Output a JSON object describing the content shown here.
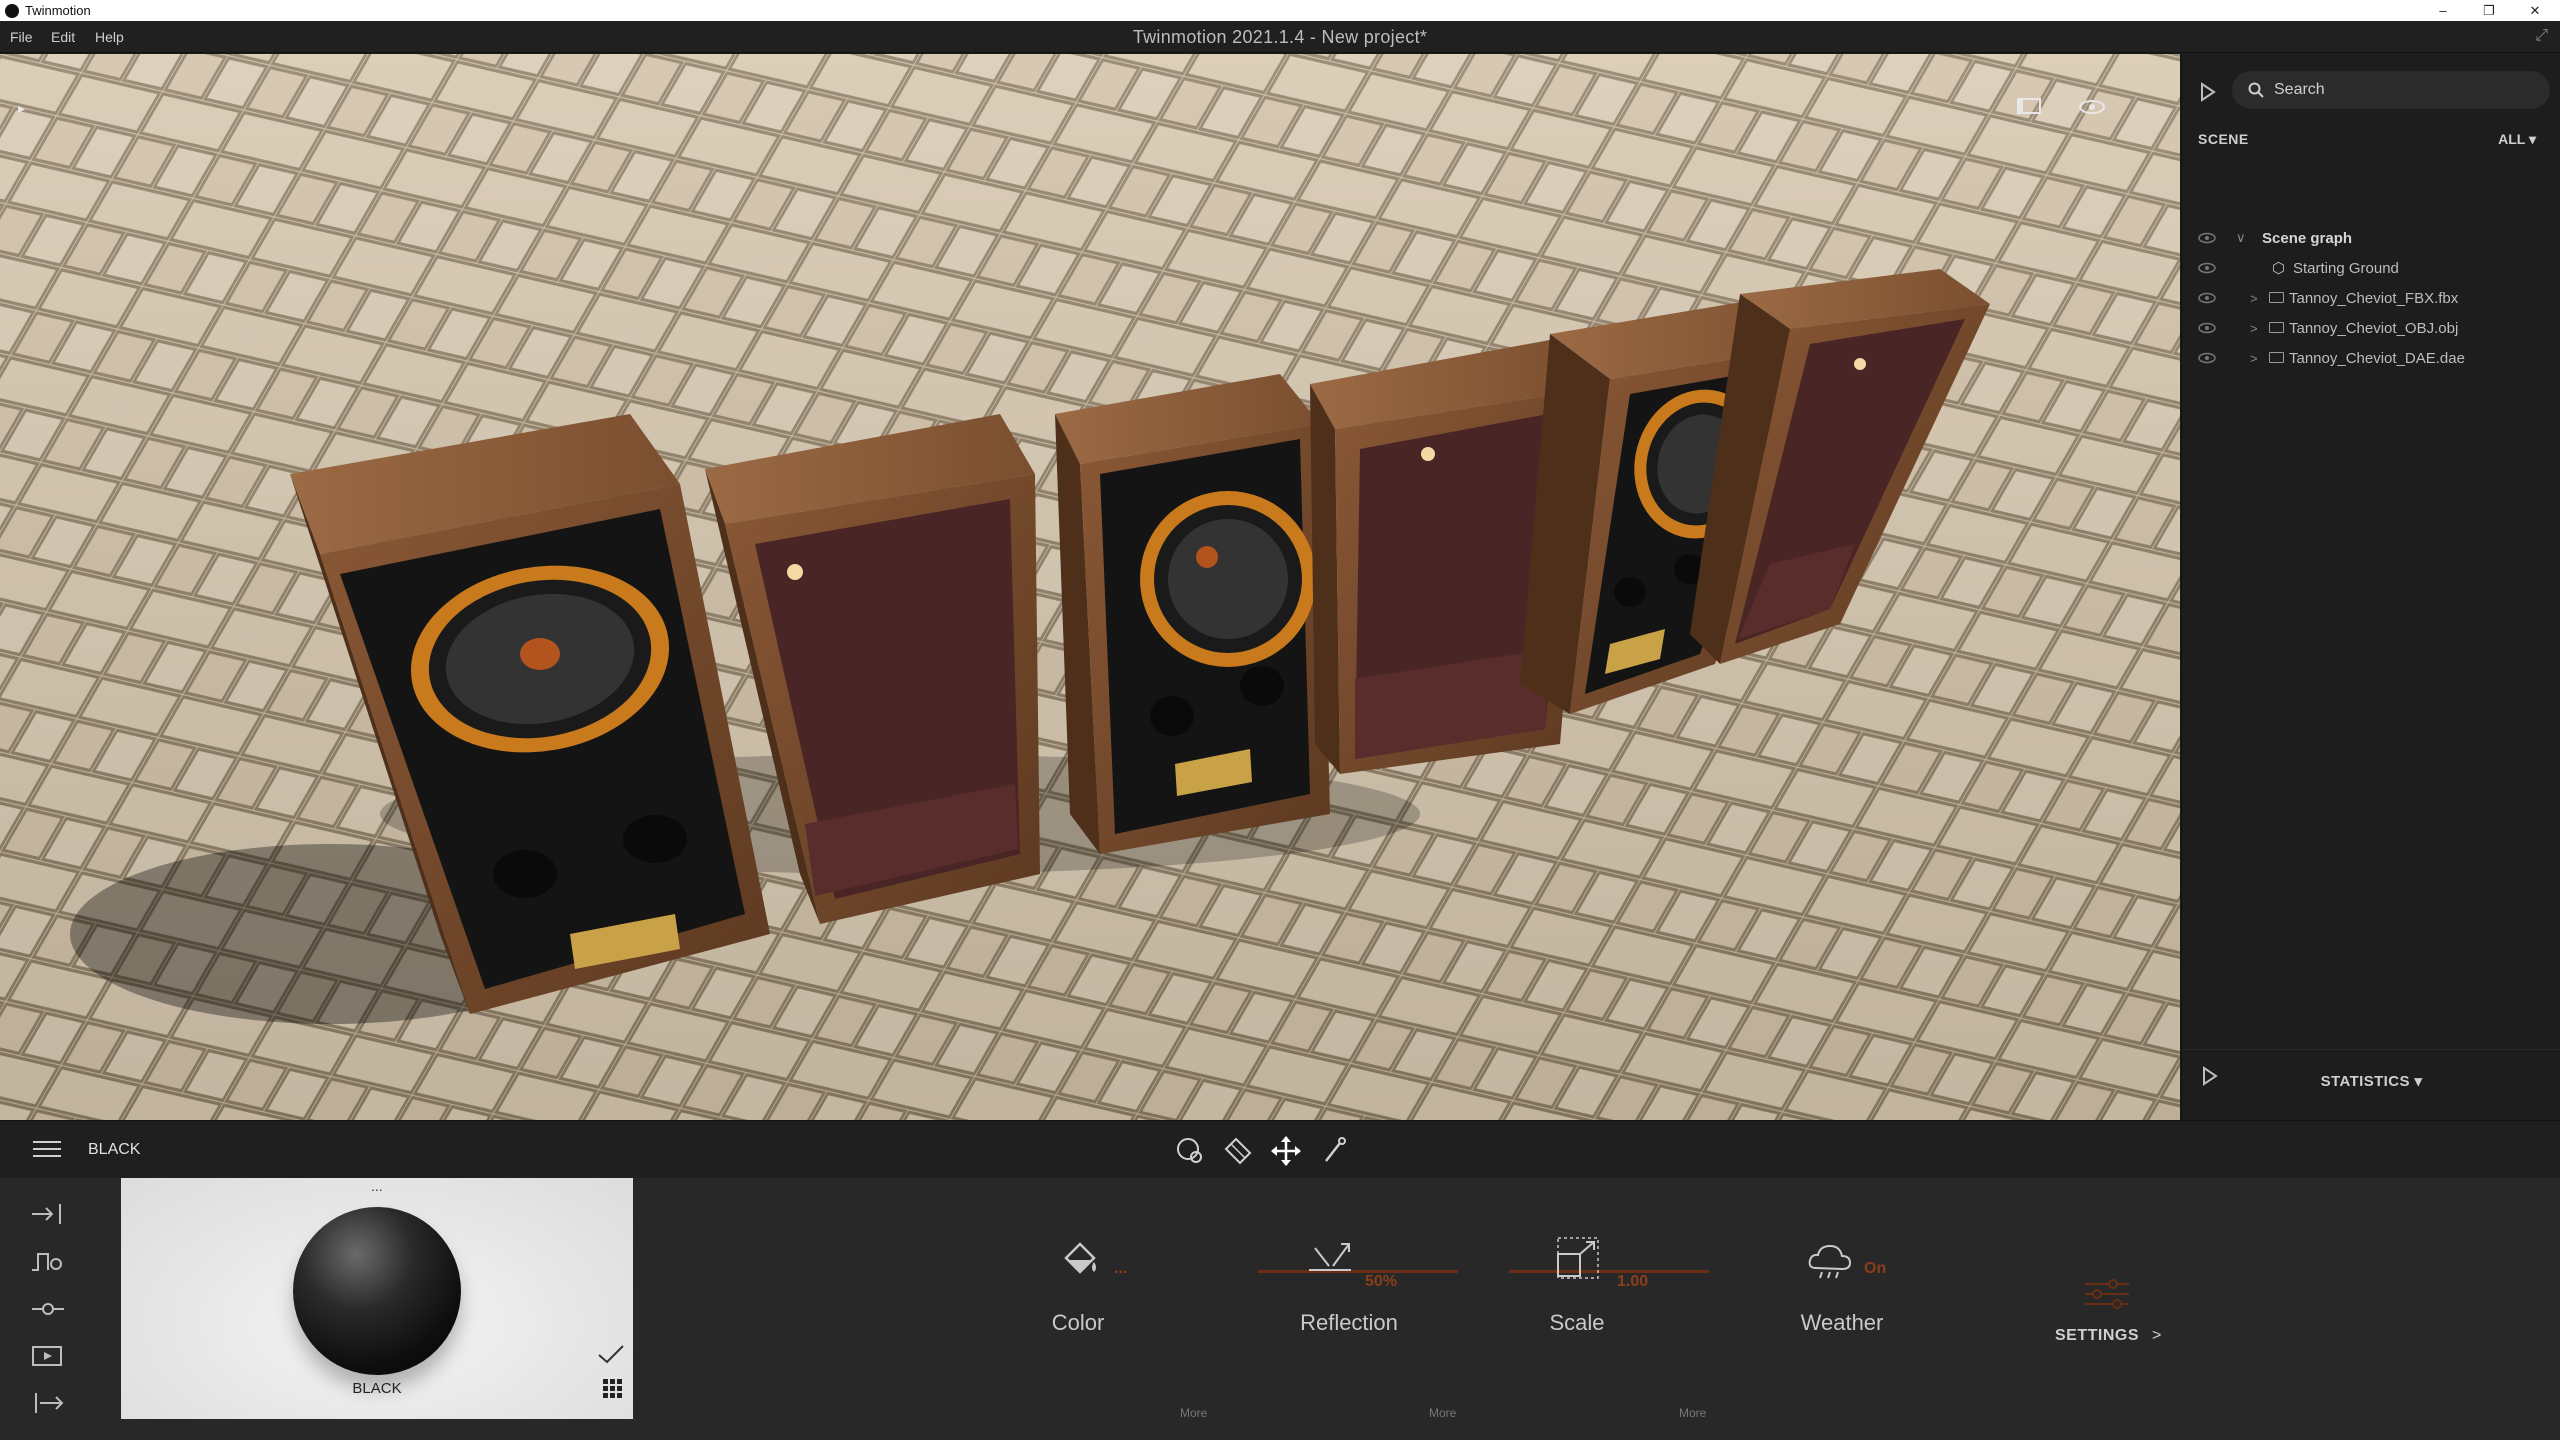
{
  "os_window": {
    "app_name": "Twinmotion",
    "min": "–",
    "max": "❐",
    "close": "✕"
  },
  "menu": {
    "items": [
      "File",
      "Edit",
      "Help"
    ],
    "title": "Twinmotion 2021.1.4 - New project*",
    "expand_icon": "expand-icon"
  },
  "search": {
    "placeholder": "Search"
  },
  "scene": {
    "label": "SCENE",
    "filter": "ALL",
    "tree": [
      {
        "label": "Scene graph"
      },
      {
        "label": "Starting Ground"
      },
      {
        "label": "Tannoy_Cheviot_FBX.fbx"
      },
      {
        "label": "Tannoy_Cheviot_OBJ.obj"
      },
      {
        "label": "Tannoy_Cheviot_DAE.dae"
      }
    ]
  },
  "statistics": {
    "label": "STATISTICS"
  },
  "bottom": {
    "material_name": "BLACK",
    "thumbnail_label": "BLACK",
    "thumbnail_menu": "...",
    "properties": {
      "color": {
        "label": "Color",
        "value": "..."
      },
      "reflection": {
        "label": "Reflection",
        "value": "50%",
        "level": 0.5
      },
      "scale": {
        "label": "Scale",
        "value": "1.00"
      },
      "weather": {
        "label": "Weather",
        "value": "On"
      }
    },
    "more_label": "More",
    "settings_label": "SETTINGS",
    "accent_color": "#8a3e1a"
  }
}
